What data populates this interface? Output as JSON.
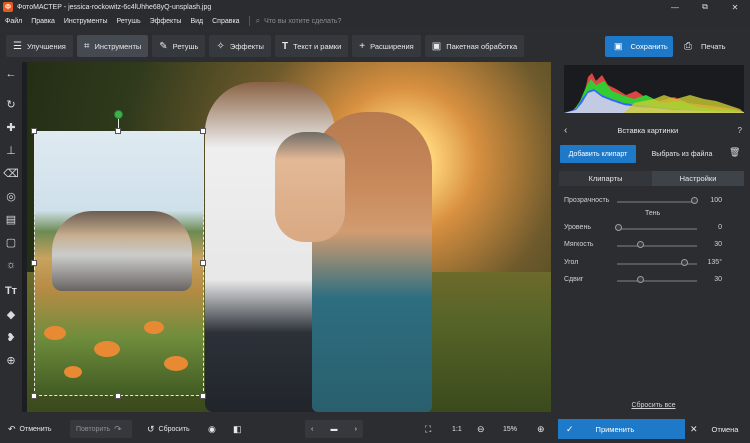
{
  "window": {
    "title": "ФотоМАСТЕР - jessica-rockowitz-6c4lUhhe68yQ-unsplash.jpg",
    "logo_letter": "Ф",
    "minimize": "—",
    "maximize": "⧉",
    "close": "✕"
  },
  "menu": {
    "items": [
      "Файл",
      "Правка",
      "Инструменты",
      "Ретушь",
      "Эффекты",
      "Вид",
      "Справка"
    ],
    "search_placeholder": "Что вы хотите сделать?"
  },
  "toolbar": {
    "tabs": [
      {
        "label": "Улучшения",
        "icon": "sliders-icon"
      },
      {
        "label": "Инструменты",
        "icon": "crop-icon",
        "active": true
      },
      {
        "label": "Ретушь",
        "icon": "brush-icon"
      },
      {
        "label": "Эффекты",
        "icon": "magic-wand-icon"
      },
      {
        "label": "Текст и рамки",
        "icon": "text-icon"
      },
      {
        "label": "Расширения",
        "icon": "plus-icon"
      },
      {
        "label": "Пакетная обработка",
        "icon": "batch-icon"
      }
    ],
    "save_label": "Сохранить",
    "print_label": "Печать"
  },
  "panel": {
    "title": "Вставка картинки",
    "add_clipart": "Добавить клипарт",
    "pick_file": "Выбрать из файла",
    "tabs": [
      "Клипарты",
      "Настройки"
    ],
    "active_tab": "Настройки",
    "opacity_label": "Прозрачность",
    "opacity_value": "100",
    "shadow_label": "Тень",
    "sliders": [
      {
        "label": "Уровень",
        "value": "0"
      },
      {
        "label": "Мягкость",
        "value": "30"
      },
      {
        "label": "Угол",
        "value": "135°"
      },
      {
        "label": "Сдвиг",
        "value": "30"
      }
    ],
    "reset_all": "Сбросить все"
  },
  "bottom": {
    "undo": "Отменить",
    "redo": "Повторить",
    "reset": "Сбросить",
    "ratio": "1:1",
    "zoom": "15%",
    "apply": "Применить",
    "cancel": "Отмена"
  },
  "colors": {
    "accent": "#1e79c9",
    "rotate_handle": "#3db04a"
  }
}
